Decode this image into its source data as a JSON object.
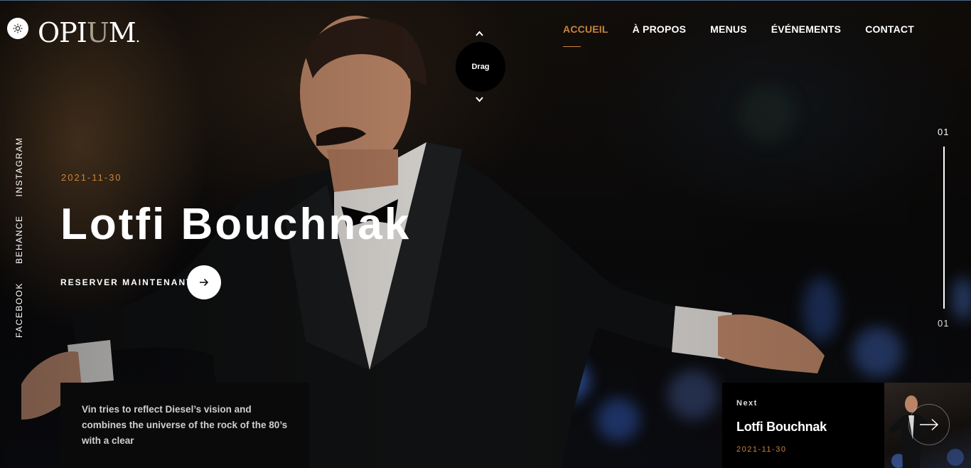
{
  "header": {
    "logo": {
      "left": "OPI",
      "u": "U",
      "right": "M",
      "dot": "."
    },
    "theme_toggle_icon": "sun-icon",
    "nav": [
      {
        "label": "ACCUEIL",
        "active": true
      },
      {
        "label": "À PROPOS",
        "active": false
      },
      {
        "label": "MENUS",
        "active": false
      },
      {
        "label": "ÉVÉNEMENTS",
        "active": false
      },
      {
        "label": "CONTACT",
        "active": false
      }
    ],
    "drag_label": "Drag"
  },
  "social": [
    "FACEBOOK",
    "BEHANCE",
    "INSTAGRAM"
  ],
  "hero": {
    "date": "2021-11-30",
    "title": "Lotfi Bouchnak",
    "cta_label": "RESERVER MAINTENANT",
    "cta_icon": "arrow-right-icon"
  },
  "slider": {
    "current": "01",
    "total": "01"
  },
  "description": {
    "text": "Vin tries to reflect Diesel’s vision and combines the universe of the rock of the 80’s with a clear"
  },
  "next": {
    "label": "Next",
    "title": "Lotfi Bouchnak",
    "date": "2021-11-30",
    "icon": "arrow-right-icon"
  },
  "colors": {
    "accent": "#c8843c",
    "background": "#0b0b0c"
  }
}
